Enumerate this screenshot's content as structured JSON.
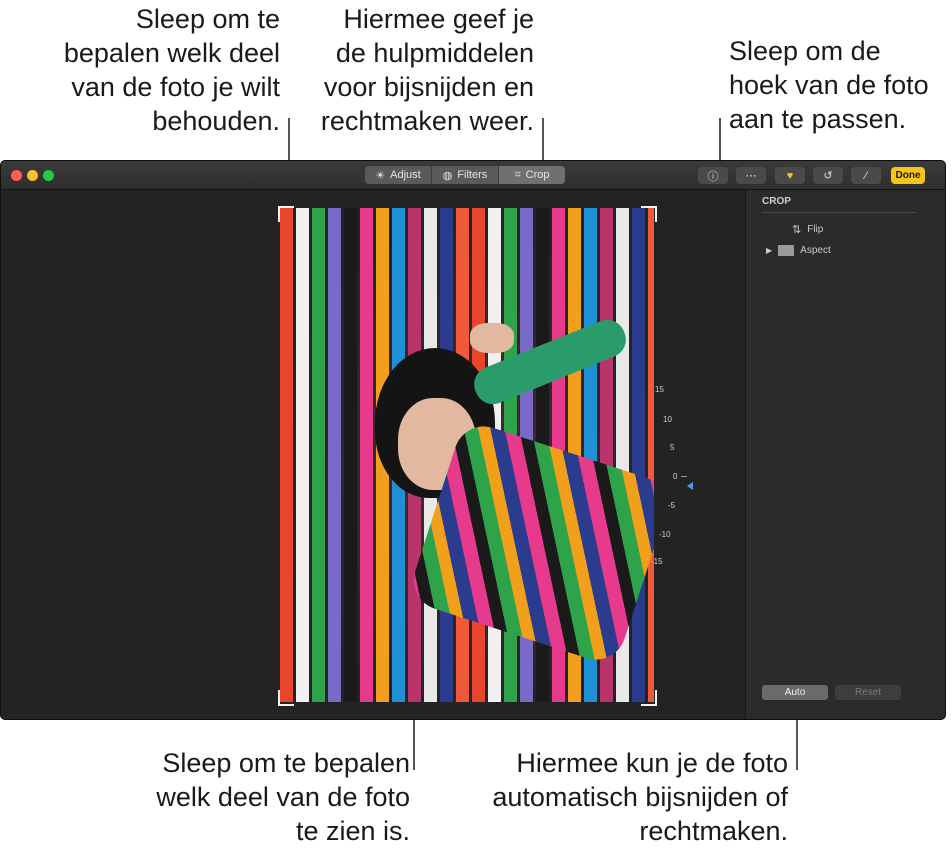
{
  "callouts": {
    "top_left": "Sleep om te\nbepalen welk deel\nvan de foto je wilt\nbehouden.",
    "top_center": "Hiermee geef je\nde hulpmiddelen\nvoor bijsnijden en\nrechtmaken weer.",
    "top_right": "Sleep om de\nhoek van de foto\naan te passen.",
    "bottom_left": "Sleep om te bepalen\nwelk deel van de foto\nte zien is.",
    "bottom_right": "Hiermee kun je de foto\nautomatisch bijsnijden of\nrechtmaken."
  },
  "toolbar": {
    "tabs": [
      {
        "label": "Adjust",
        "icon": "sun-icon"
      },
      {
        "label": "Filters",
        "icon": "filters-icon"
      },
      {
        "label": "Crop",
        "icon": "crop-icon"
      }
    ],
    "active_tab": "Crop",
    "done_label": "Done",
    "icons": [
      "info-icon",
      "more-icon",
      "favorite-heart-icon",
      "rotate-icon",
      "enhance-wand-icon"
    ]
  },
  "dial": {
    "labels": [
      "15",
      "10",
      "5",
      "0",
      "-5",
      "-10",
      "-15"
    ],
    "current": 0
  },
  "sidebar": {
    "title": "CROP",
    "items": [
      {
        "label": "Flip",
        "icon": "flip-icon"
      },
      {
        "label": "Aspect",
        "icon": "aspect-icon"
      }
    ],
    "auto_label": "Auto",
    "reset_label": "Reset"
  },
  "colors": {
    "done_button": "#f5c518",
    "dial_pointer": "#4b9cf0",
    "stripes": [
      "#e8452d",
      "#f0f0f0",
      "#2fa34a",
      "#7a6ac8",
      "#1a1a1a",
      "#e83a8c",
      "#f2a01c",
      "#1f8fd6",
      "#b8346a",
      "#e8e8e8",
      "#2b3c8f",
      "#f05a3a"
    ]
  }
}
